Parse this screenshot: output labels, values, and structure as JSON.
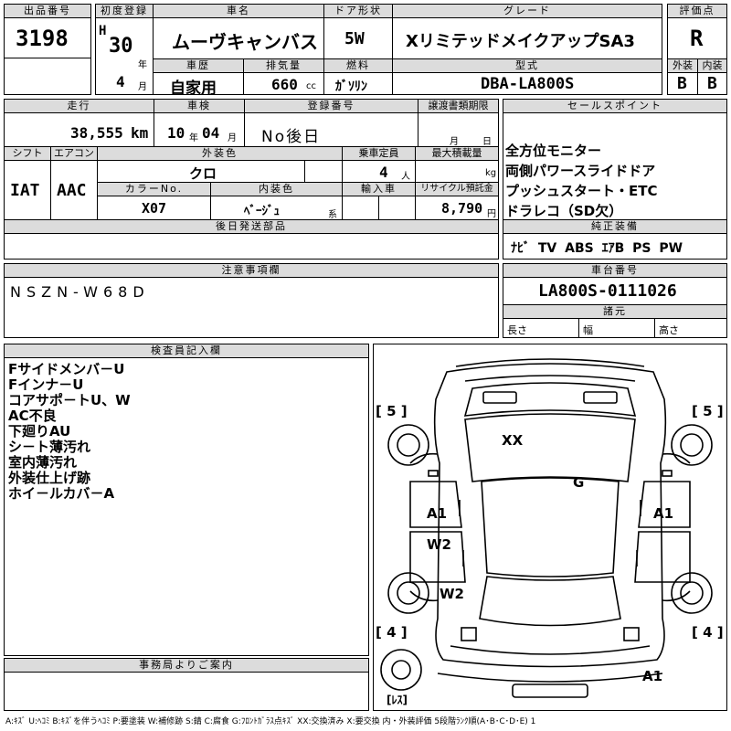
{
  "header": {
    "lot_label": "出品番号",
    "lot_no": "3198",
    "first_reg_label": "初度登録",
    "era": "H",
    "year": "30",
    "year_unit": "年",
    "month": "4",
    "month_unit": "月",
    "car_name_label": "車名",
    "car_name": "ムーヴキャンバス",
    "door_label": "ドア形状",
    "door": "5W",
    "grade_label": "グレード",
    "grade": "XリミテッドメイクアップSA3",
    "score_label": "評価点",
    "score": "R",
    "history_label": "車歴",
    "history": "自家用",
    "displacement_label": "排気量",
    "displacement": "660",
    "cc_unit": "cc",
    "fuel_label": "燃料",
    "fuel": "ｶﾞｿﾘﾝ",
    "model_label": "型式",
    "model": "DBA-LA800S",
    "exterior_label": "外装",
    "exterior": "B",
    "interior_label": "内装",
    "interior": "B"
  },
  "mid": {
    "mileage_label": "走行",
    "mileage": "38,555",
    "mileage_unit": "km",
    "inspection_label": "車検",
    "insp_year": "10",
    "insp_year_unit": "年",
    "insp_month": "04",
    "insp_month_unit": "月",
    "reg_no_label": "登録番号",
    "reg_no": "No後日",
    "transfer_label": "譲渡書類期限",
    "transfer_month": "月",
    "transfer_day": "日",
    "shift_label": "シフト",
    "shift": "IAT",
    "ac_label": "エアコン",
    "ac": "AAC",
    "ext_color_label": "外装色",
    "ext_color": "クロ",
    "capacity_label": "乗車定員",
    "capacity": "4",
    "capacity_unit": "人",
    "max_load_label": "最大積載量",
    "max_load_unit": "kg",
    "color_no_label": "カラーNo.",
    "color_no": "X07",
    "int_color_label": "内装色",
    "int_color": "ﾍﾞｰｼﾞｭ",
    "int_color_unit": "系",
    "import_label": "輸入車",
    "recycle_label": "リサイクル預託金",
    "recycle": "8,790",
    "recycle_unit": "円",
    "later_parts_label": "後日発送部品"
  },
  "sales": {
    "label": "セールスポイント",
    "points": [
      "全方位モニター",
      "両側パワースライドドア",
      "プッシュスタート・ETC",
      "ドラレコ（SD欠）"
    ],
    "equip_label": "純正装備",
    "equip": "ﾅﾋﾞ TV ABS ｴｱB PS PW"
  },
  "notes": {
    "label": "注意事項欄",
    "text": "NSZN-W68D"
  },
  "chassis": {
    "label": "車台番号",
    "number": "LA800S-0111026",
    "spec_label": "諸元",
    "length_label": "長さ",
    "width_label": "幅",
    "height_label": "高さ"
  },
  "inspector": {
    "label": "検査員記入欄",
    "lines": [
      "Fサイドメンバ－U",
      "Fインナ－U",
      "コアサポ－トU、W",
      "AC不良",
      "下廻りAU",
      "シ－ト薄汚れ",
      "室内薄汚れ",
      "外装仕上げ跡",
      "ホイ－ルカバ－A"
    ]
  },
  "office": {
    "label": "事務局よりご案内"
  },
  "diagram": {
    "tire_fl": "[ 5 ]",
    "tire_fr": "[ 5 ]",
    "tire_rl": "[ 4 ]",
    "tire_rr": "[ 4 ]",
    "m_xx": "XX",
    "m_g": "G",
    "m_a1_left": "A1",
    "m_a1_right": "A1",
    "m_w2_upper": "W2",
    "m_w2_lower": "W2",
    "m_a1_bottom": "A1",
    "spare": "[ﾚｽ]"
  },
  "legend": "A:ｷｽﾞ U:ﾍｺﾐ B:ｷｽﾞを伴うﾍｺﾐ P:要塗装 W:補修跡 S:錆 C:腐食 G:ﾌﾛﾝﾄｶﾞﾗｽ点ｷｽﾞ XX:交換済み X:要交換 内・外装評価 5段階ﾗﾝｸ順(A･B･C･D･E) 1"
}
